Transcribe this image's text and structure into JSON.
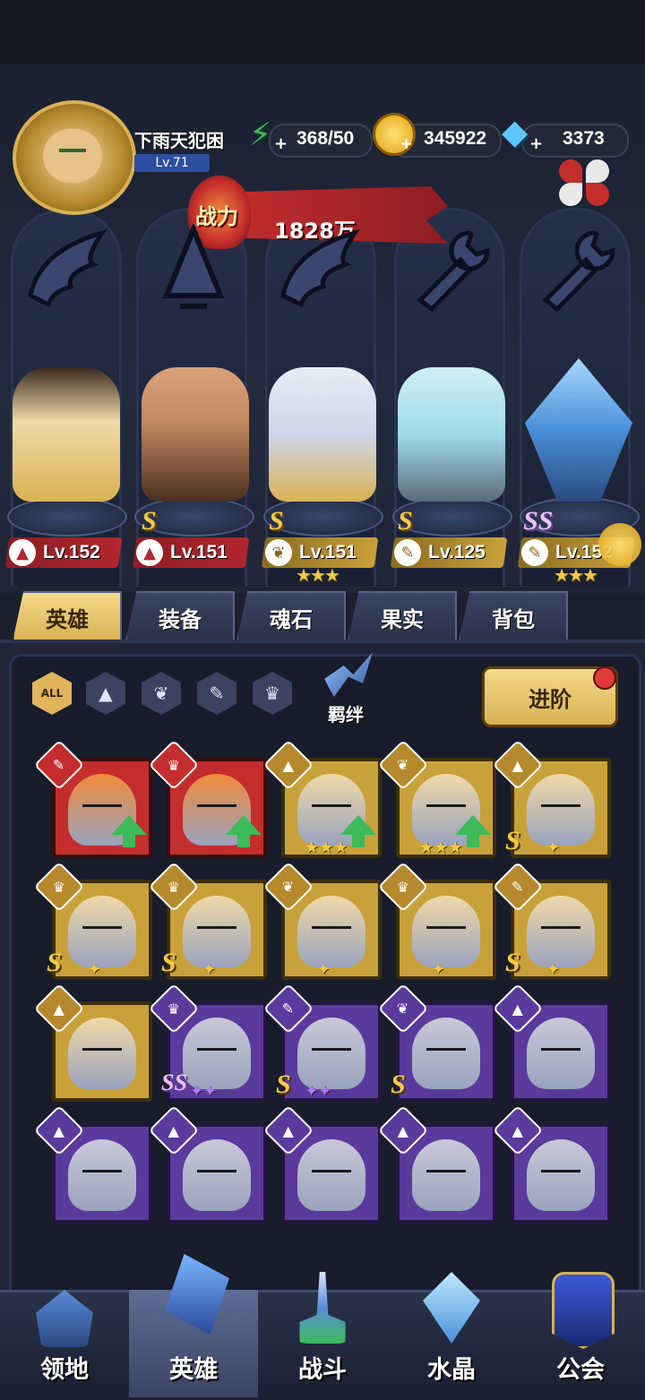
{
  "player": {
    "name": "下雨天犯困",
    "level": "Lv.71"
  },
  "resources": {
    "energy": "368/50",
    "gold": "345922",
    "diamond": "3373"
  },
  "power": {
    "label": "战力",
    "value": "1828万"
  },
  "lineup": [
    {
      "level": "Lv.152",
      "rank": "",
      "stars": "",
      "class_icon": "helmet-icon"
    },
    {
      "level": "Lv.151",
      "rank": "S",
      "stars": "",
      "class_icon": "helmet-icon"
    },
    {
      "level": "Lv.151",
      "rank": "S",
      "stars": "★★★",
      "class_icon": "wing-icon"
    },
    {
      "level": "Lv.125",
      "rank": "S",
      "stars": "",
      "class_icon": "wrench-icon"
    },
    {
      "level": "Lv.152",
      "rank": "SS",
      "stars": "★★★",
      "class_icon": "wrench-icon"
    }
  ],
  "tabs": [
    "英雄",
    "装备",
    "魂石",
    "果实",
    "背包"
  ],
  "filters": {
    "all": "ALL",
    "bond": "羁绊"
  },
  "advance_button": "进阶",
  "hero_grid": [
    {
      "frame": "red",
      "class": "wrench",
      "rank": "",
      "stars": "",
      "upgrade": true
    },
    {
      "frame": "red",
      "class": "beast",
      "rank": "",
      "stars": "",
      "upgrade": true
    },
    {
      "frame": "gold",
      "class": "helmet",
      "rank": "",
      "stars": "★★★",
      "upgrade": true
    },
    {
      "frame": "gold",
      "class": "wing",
      "rank": "",
      "stars": "★★★",
      "upgrade": true
    },
    {
      "frame": "gold",
      "class": "helmet",
      "rank": "S",
      "stars": "✦",
      "upgrade": false
    },
    {
      "frame": "gold",
      "class": "beast",
      "rank": "S",
      "stars": "✦",
      "upgrade": false
    },
    {
      "frame": "gold",
      "class": "beast",
      "rank": "S",
      "stars": "✦",
      "upgrade": false
    },
    {
      "frame": "gold",
      "class": "wing",
      "rank": "",
      "stars": "✦",
      "upgrade": false
    },
    {
      "frame": "gold",
      "class": "beast",
      "rank": "",
      "stars": "✦",
      "upgrade": false
    },
    {
      "frame": "gold",
      "class": "wrench",
      "rank": "S",
      "stars": "✦",
      "upgrade": false
    },
    {
      "frame": "gold",
      "class": "helmet",
      "rank": "",
      "stars": "",
      "upgrade": false
    },
    {
      "frame": "purple",
      "class": "beast",
      "rank": "SS",
      "stars": "✦✦",
      "upgrade": false
    },
    {
      "frame": "purple",
      "class": "wrench",
      "rank": "S",
      "stars": "✦✦",
      "upgrade": false
    },
    {
      "frame": "purple",
      "class": "wing",
      "rank": "S",
      "stars": "",
      "upgrade": false
    },
    {
      "frame": "purple",
      "class": "helmet",
      "rank": "",
      "stars": "",
      "upgrade": false
    },
    {
      "frame": "purple",
      "class": "helmet",
      "rank": "",
      "stars": "",
      "upgrade": false
    },
    {
      "frame": "purple",
      "class": "helmet",
      "rank": "",
      "stars": "",
      "upgrade": false
    },
    {
      "frame": "purple",
      "class": "helmet",
      "rank": "",
      "stars": "",
      "upgrade": false
    },
    {
      "frame": "purple",
      "class": "helmet",
      "rank": "",
      "stars": "",
      "upgrade": false
    },
    {
      "frame": "purple",
      "class": "helmet",
      "rank": "",
      "stars": "",
      "upgrade": false
    }
  ],
  "nav": [
    "领地",
    "英雄",
    "战斗",
    "水晶",
    "公会"
  ],
  "colors": {
    "accent_gold": "#e0b45a",
    "red_banner": "#b3262e",
    "upgrade_green": "#3dba5a"
  }
}
